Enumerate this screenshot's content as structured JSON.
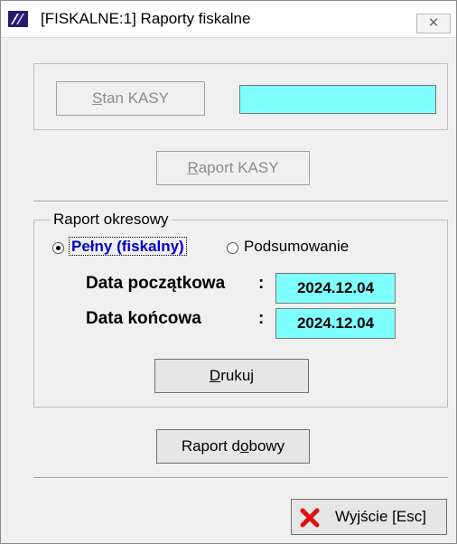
{
  "window": {
    "title": "[FISKALNE:1]  Raporty fiskalne",
    "close_glyph": "✕"
  },
  "kasa": {
    "stan_button": {
      "pre": "",
      "hotkey": "S",
      "post": "tan KASY",
      "enabled": false
    },
    "stan_value": "",
    "raport_button": {
      "pre": "",
      "hotkey": "R",
      "post": "aport KASY",
      "enabled": false
    }
  },
  "okresowy": {
    "legend": "Raport okresowy",
    "options": [
      {
        "label": "Pełny (fiskalny)",
        "selected": true
      },
      {
        "label": "Podsumowanie",
        "selected": false
      }
    ],
    "start_label": "Data początkowa",
    "start_colon": ":",
    "start_value": "2024.12.04",
    "end_label": "Data końcowa",
    "end_colon": ":",
    "end_value": "2024.12.04",
    "print_button": {
      "pre": "",
      "hotkey": "D",
      "post": "rukuj"
    }
  },
  "dobowy_button": {
    "pre": "Raport d",
    "hotkey": "o",
    "post": "bowy"
  },
  "exit_button": {
    "label": "Wyjście  [Esc]"
  },
  "colors": {
    "field_bg": "#80ffff",
    "selected_option_text": "#0000cc",
    "exit_icon": "#e01010"
  },
  "icons": [
    "app-icon",
    "close-icon",
    "radio-icon",
    "x-mark-icon"
  ]
}
